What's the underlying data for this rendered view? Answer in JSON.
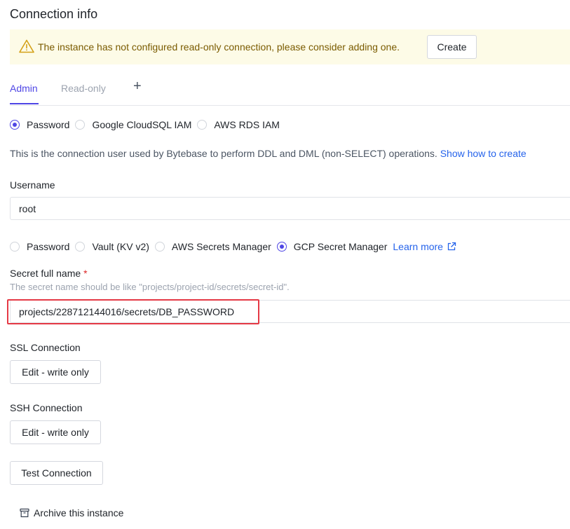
{
  "page_title": "Connection info",
  "alert": {
    "message": "The instance has not configured read-only connection, please consider adding one.",
    "button": "Create"
  },
  "tabs": {
    "admin": "Admin",
    "read_only": "Read-only",
    "add": "+"
  },
  "auth_type": {
    "options": [
      "Password",
      "Google CloudSQL IAM",
      "AWS RDS IAM"
    ],
    "selected": "Password"
  },
  "description": {
    "text": "This is the connection user used by Bytebase to perform DDL and DML (non-SELECT) operations.",
    "link": "Show how to create"
  },
  "username": {
    "label": "Username",
    "value": "root"
  },
  "password_source": {
    "options": [
      "Password",
      "Vault (KV v2)",
      "AWS Secrets Manager",
      "GCP Secret Manager"
    ],
    "selected": "GCP Secret Manager",
    "learn_more": "Learn more"
  },
  "secret": {
    "label": "Secret full name",
    "required_mark": "*",
    "hint": "The secret name should be like \"projects/project-id/secrets/secret-id\".",
    "value": "projects/228712144016/secrets/DB_PASSWORD"
  },
  "ssl": {
    "label": "SSL Connection",
    "button": "Edit - write only"
  },
  "ssh": {
    "label": "SSH Connection",
    "button": "Edit - write only"
  },
  "test_button": "Test Connection",
  "archive": "Archive this instance",
  "colors": {
    "accent": "#4f46e5",
    "link": "#2563eb",
    "warning_bg": "#fdfbe7",
    "highlight": "#e53945"
  }
}
